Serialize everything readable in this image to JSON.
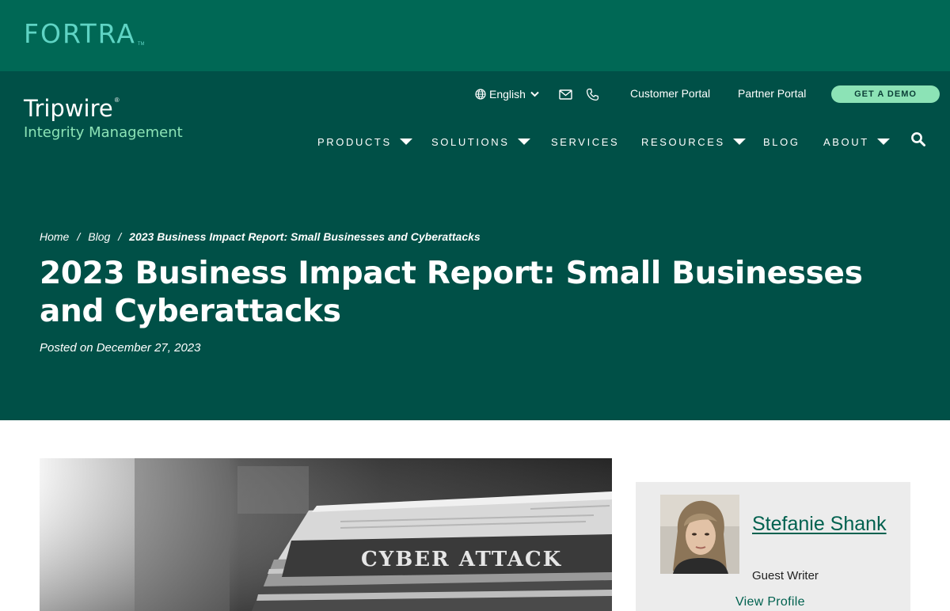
{
  "fortra": {
    "brand": "FORTRA",
    "tm": "TM"
  },
  "site": {
    "name": "Tripwire",
    "reg": "®",
    "subtitle": "Integrity Management"
  },
  "utility": {
    "language": "English",
    "customer_portal": "Customer Portal",
    "partner_portal": "Partner Portal",
    "demo": "GET A DEMO"
  },
  "nav": {
    "products": "PRODUCTS",
    "solutions": "SOLUTIONS",
    "services": "SERVICES",
    "resources": "RESOURCES",
    "blog": "BLOG",
    "about": "ABOUT"
  },
  "breadcrumb": {
    "home": "Home",
    "blog": "Blog",
    "current": "2023 Business Impact Report: Small Businesses and Cyberattacks",
    "separator": "/"
  },
  "article": {
    "title": "2023 Business Impact Report: Small Businesses and Cyberattacks",
    "posted": "Posted on December 27, 2023",
    "image_headline": "CYBER ATTACK"
  },
  "author": {
    "name": "Stefanie Shank",
    "role": "Guest Writer",
    "view_profile": "View Profile"
  },
  "colors": {
    "fortra_bar": "#006855",
    "header": "#005047",
    "accent_mint": "#8ce3b6",
    "fortra_logo": "#5fd4c4",
    "link_green": "#00614f",
    "card_bg": "#ececec"
  },
  "icons": [
    "globe-icon",
    "chevron-down-icon",
    "mail-icon",
    "phone-icon",
    "caret-down-icon",
    "search-icon"
  ]
}
